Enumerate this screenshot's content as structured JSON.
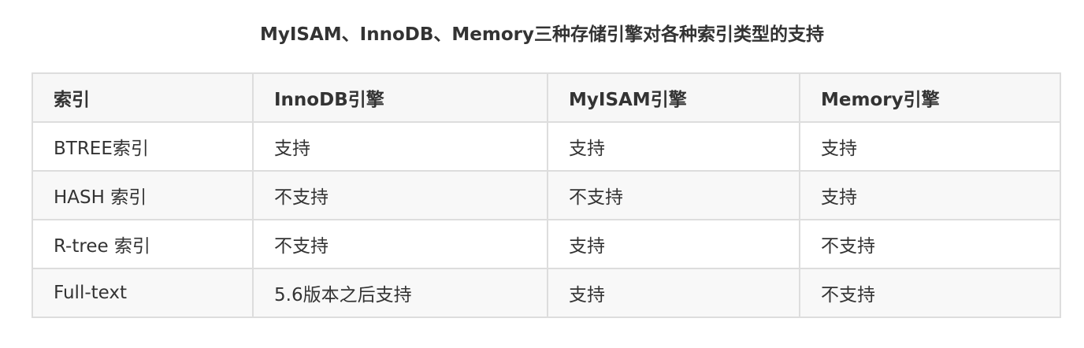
{
  "title": "MyISAM、InnoDB、Memory三种存储引擎对各种索引类型的支持",
  "table": {
    "headers": [
      "索引",
      "InnoDB引擎",
      "MyISAM引擎",
      "Memory引擎"
    ],
    "rows": [
      [
        "BTREE索引",
        "支持",
        "支持",
        "支持"
      ],
      [
        "HASH 索引",
        "不支持",
        "不支持",
        "支持"
      ],
      [
        "R-tree 索引",
        "不支持",
        "支持",
        "不支持"
      ],
      [
        "Full-text",
        "5.6版本之后支持",
        "支持",
        "不支持"
      ]
    ]
  }
}
